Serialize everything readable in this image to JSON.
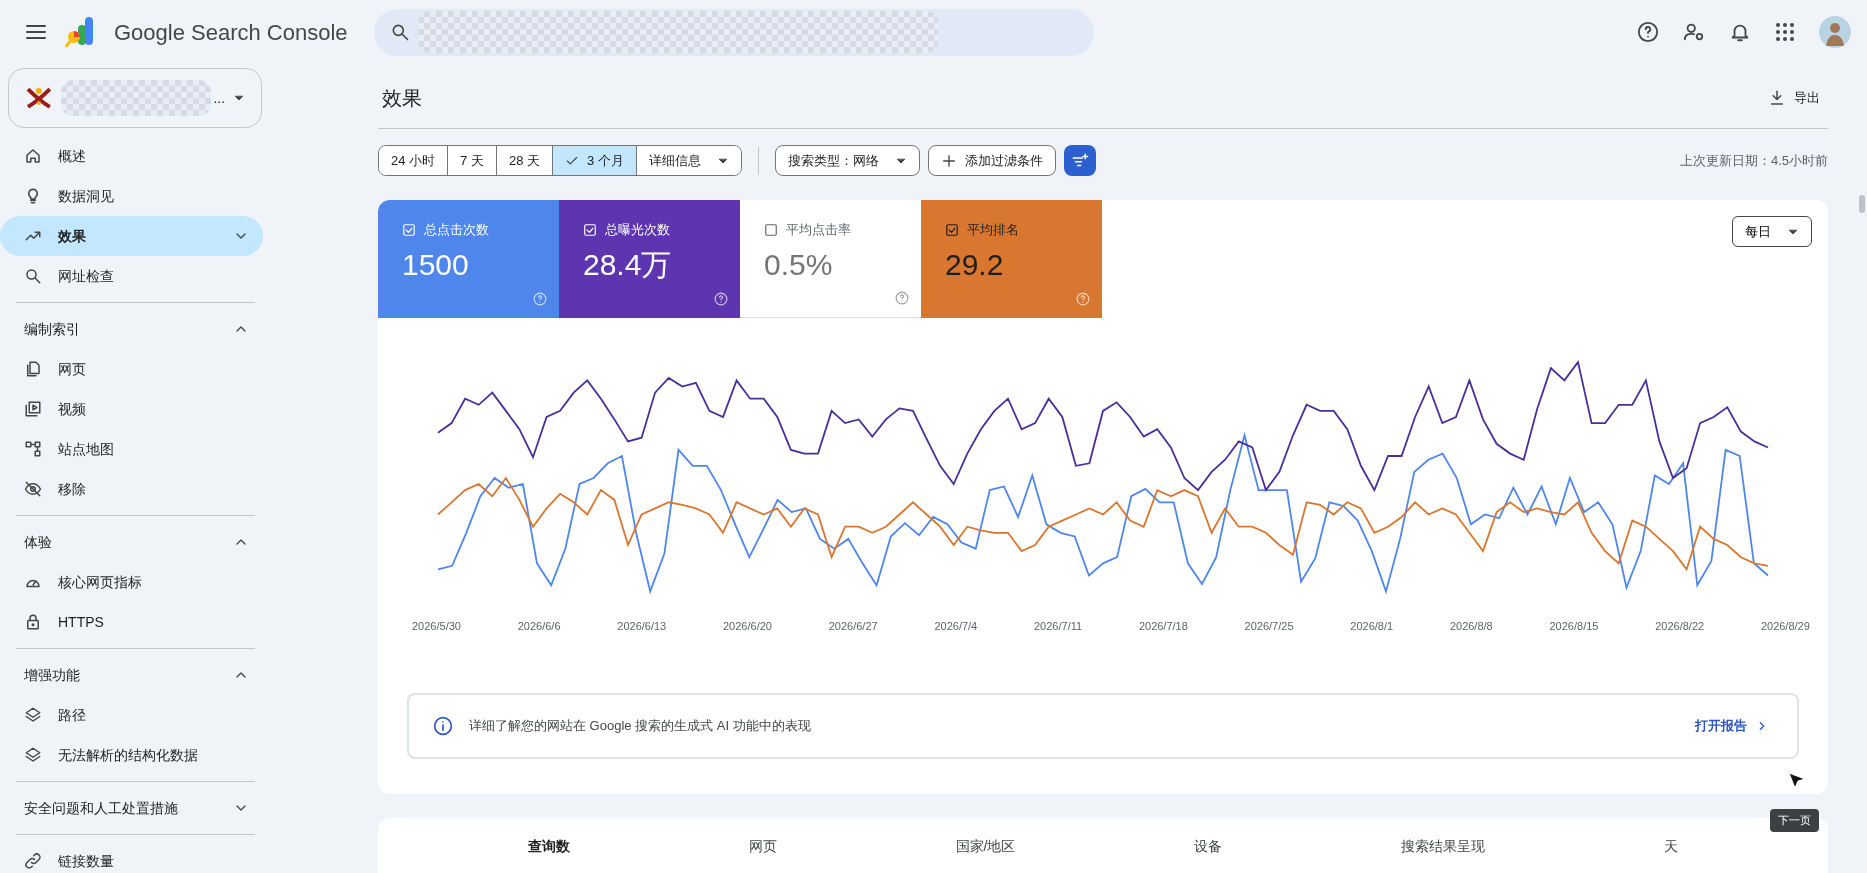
{
  "header": {
    "product": "Google Search Console",
    "property_suffix": "..."
  },
  "nav": [
    {
      "label": "概述",
      "selected": false
    },
    {
      "label": "数据洞见",
      "selected": false
    },
    {
      "label": "效果",
      "selected": true,
      "expanded": false
    },
    {
      "label": "网址检查",
      "selected": false
    }
  ],
  "sections": [
    {
      "title": "编制索引",
      "expanded": true,
      "items": [
        {
          "label": "网页",
          "selected": false
        },
        {
          "label": "视频",
          "selected": false
        },
        {
          "label": "站点地图",
          "selected": false
        },
        {
          "label": "移除",
          "selected": false
        }
      ]
    },
    {
      "title": "体验",
      "expanded": true,
      "items": [
        {
          "label": "核心网页指标",
          "selected": false
        },
        {
          "label": "HTTPS",
          "selected": false
        }
      ]
    },
    {
      "title": "增强功能",
      "expanded": true,
      "items": [
        {
          "label": "路径",
          "selected": false
        },
        {
          "label": "无法解析的结构化数据",
          "selected": false
        }
      ]
    },
    {
      "title": "安全问题和人工处置措施",
      "expanded": false
    }
  ],
  "footer_nav": [
    {
      "label": "链接数量",
      "selected": false
    }
  ],
  "page": {
    "title": "效果",
    "export": "导出"
  },
  "date_ranges": [
    {
      "label": "24 小时",
      "selected": false
    },
    {
      "label": "7 天",
      "selected": false
    },
    {
      "label": "28 天",
      "selected": false
    },
    {
      "label": "3 个月",
      "selected": true
    }
  ],
  "more_dropdown": "详细信息",
  "filters": {
    "search_type": "搜索类型：网络",
    "add": "添加过滤条件"
  },
  "last_updated": "上次更新日期：4.5小时前",
  "metrics": [
    {
      "label": "总点击次数",
      "value": "1500",
      "checked": true,
      "color": "#4e86ec"
    },
    {
      "label": "总曝光次数",
      "value": "28.4万",
      "checked": true,
      "color": "#5e35b1"
    },
    {
      "label": "平均点击率",
      "value": "0.5%",
      "checked": false
    },
    {
      "label": "平均排名",
      "value": "29.2",
      "checked": true,
      "color": "#d9762f"
    }
  ],
  "granularity": "每日",
  "x_labels": [
    "2026/5/30",
    "2026/6/6",
    "2026/6/13",
    "2026/6/20",
    "2026/6/27",
    "2026/7/4",
    "2026/7/11",
    "2026/7/18",
    "2026/7/25",
    "2026/8/1",
    "2026/8/8",
    "2026/8/15",
    "2026/8/22",
    "2026/8/29"
  ],
  "info": {
    "text": "详细了解您的网站在 Google 搜索的生成式 AI 功能中的表现",
    "link": "打开报告"
  },
  "tooltip": "下一页",
  "tabs": [
    {
      "label": "查询数",
      "selected": true
    },
    {
      "label": "网页",
      "selected": false
    },
    {
      "label": "国家/地区",
      "selected": false
    },
    {
      "label": "设备",
      "selected": false
    },
    {
      "label": "搜索结果呈现",
      "selected": false
    },
    {
      "label": "天",
      "selected": false
    }
  ]
}
